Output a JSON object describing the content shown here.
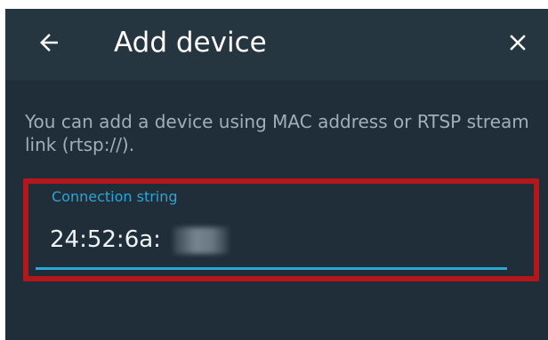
{
  "app_bar": {
    "title": "Add device",
    "back_icon": "arrow-left-icon",
    "close_icon": "close-icon"
  },
  "description": "You can add a device using MAC address or RTSP stream link (rtsp://).",
  "connection_field": {
    "label": "Connection string",
    "value": "24:52:6a:",
    "value_redacted": true
  },
  "colors": {
    "background": "#1f2e38",
    "app_bar": "#263641",
    "accent": "#2aa6d9",
    "highlight": "#b3171c",
    "text_primary": "#ffffff",
    "text_secondary": "#9fb0bb"
  }
}
